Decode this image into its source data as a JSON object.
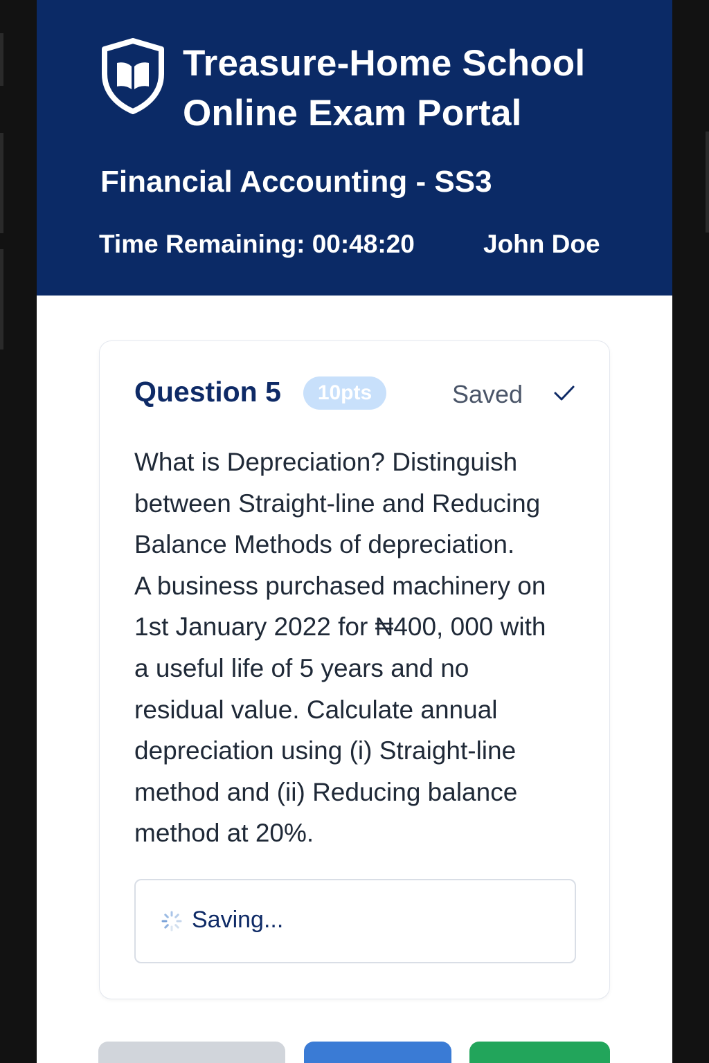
{
  "header": {
    "title": "Treasure-Home School\nOnline Exam Portal",
    "subject": "Financial Accounting - SS3",
    "timer_label": "Time Remaining: 00:48:20",
    "user_name": "John Doe",
    "logo_icon": "shield-book-icon"
  },
  "question": {
    "title": "Question 5",
    "points": "10pts",
    "status": "Saved",
    "status_icon": "check-icon",
    "text": "What is Depreciation? Distinguish\nbetween Straight-line and Reducing\nBalance Methods of depreciation.\nA business purchased machinery on\n1st January 2022 for ₦400, 000 with\na useful life of 5 years and no\nresidual value. Calculate annual\ndepreciation using (i) Straight-line\nmethod and (ii) Reducing balance\nmethod at 20%."
  },
  "answer": {
    "status_text": "Saving...",
    "status_icon": "spinner-icon"
  },
  "colors": {
    "header_bg": "#0b2a66",
    "points_badge": "#c8e0fb",
    "prev_button": "#d1d5db",
    "next_button": "#3a7bd5",
    "submit_button": "#22a55b"
  }
}
